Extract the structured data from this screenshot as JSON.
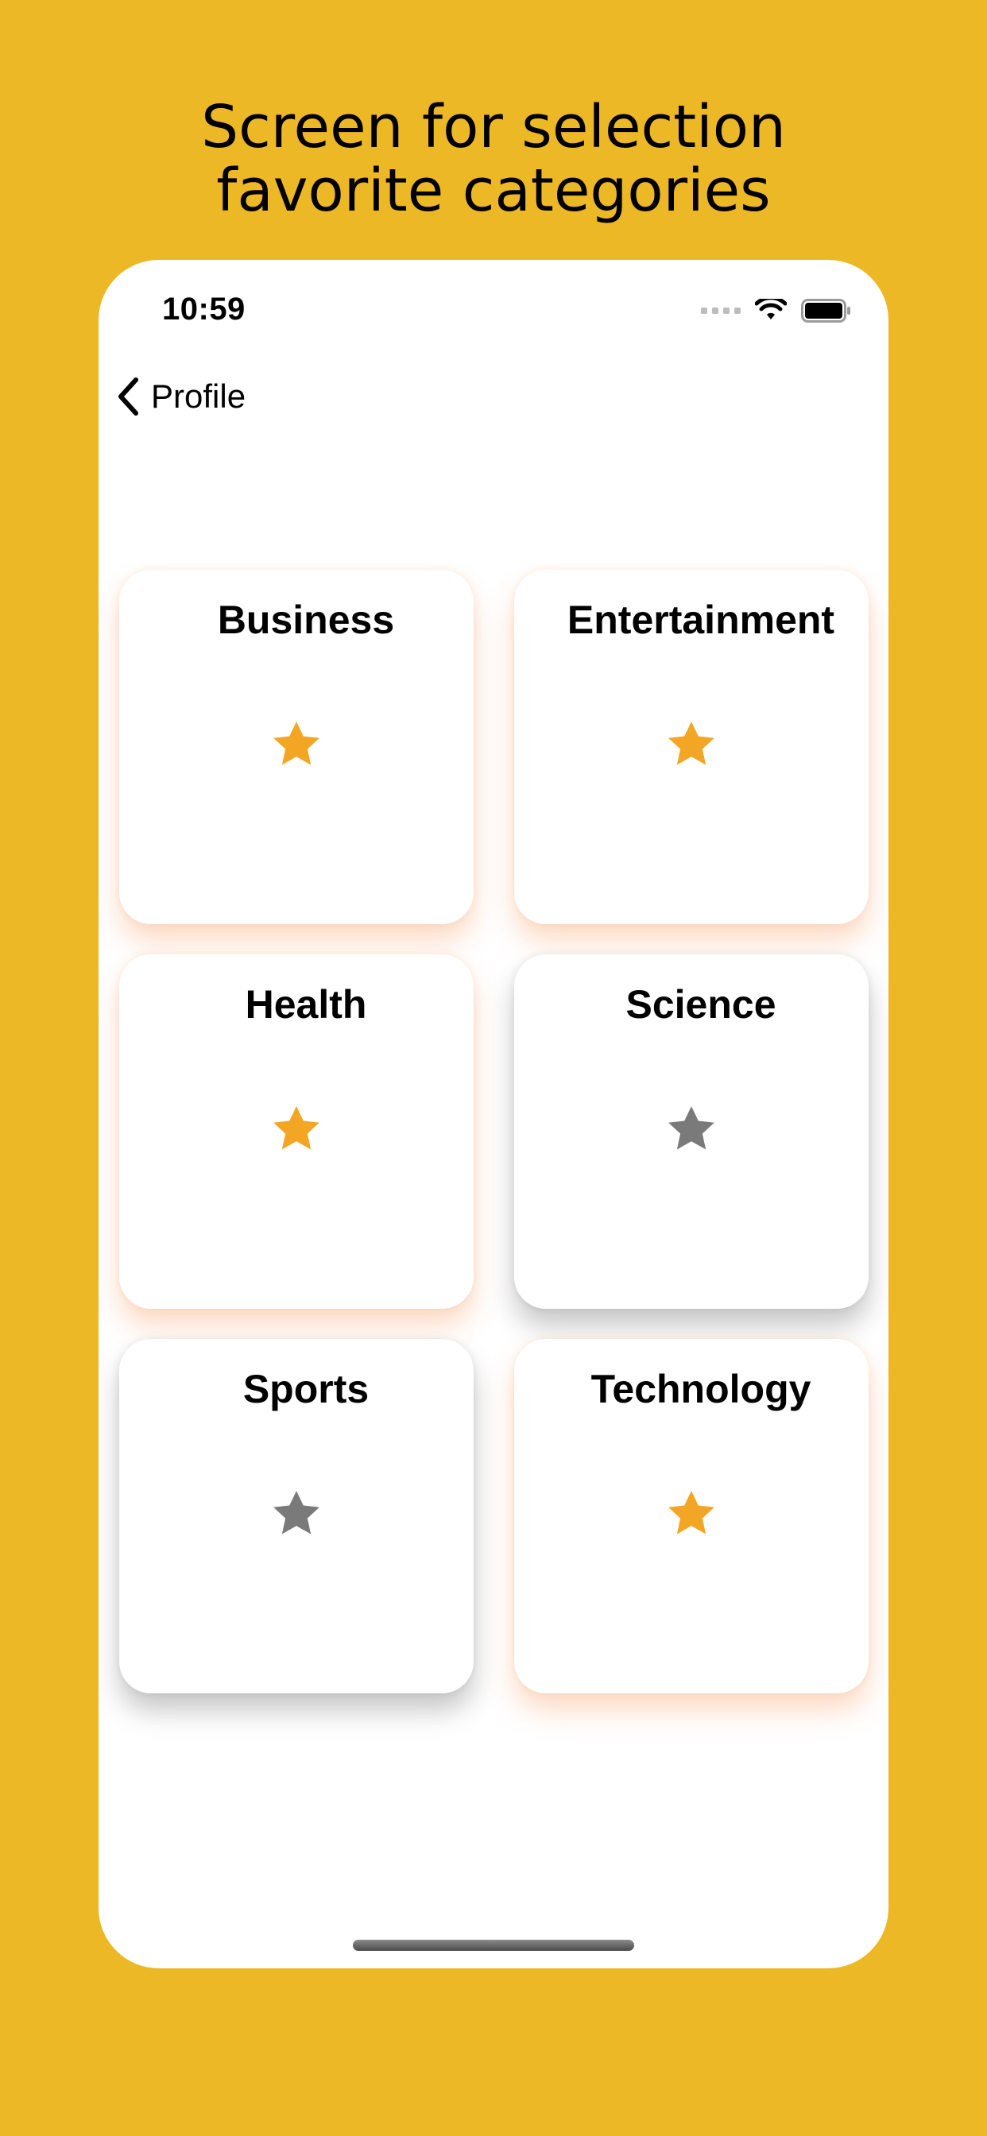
{
  "headline": {
    "line1": "Screen for selection",
    "line2": "favorite categories"
  },
  "status_bar": {
    "time": "10:59",
    "icons": [
      "signal-dots-icon",
      "wifi-icon",
      "battery-icon"
    ]
  },
  "nav": {
    "back_label": "Profile",
    "back_icon": "chevron-left-icon"
  },
  "categories": [
    {
      "label": "Business",
      "favorite": true
    },
    {
      "label": "Entertainment",
      "favorite": true
    },
    {
      "label": "Health",
      "favorite": true
    },
    {
      "label": "Science",
      "favorite": false
    },
    {
      "label": "Sports",
      "favorite": false
    },
    {
      "label": "Technology",
      "favorite": true
    }
  ],
  "colors": {
    "background": "#ECB826",
    "star_selected": "#F2A623",
    "star_unselected": "#7A7A7A",
    "card": "#FFFFFF"
  }
}
